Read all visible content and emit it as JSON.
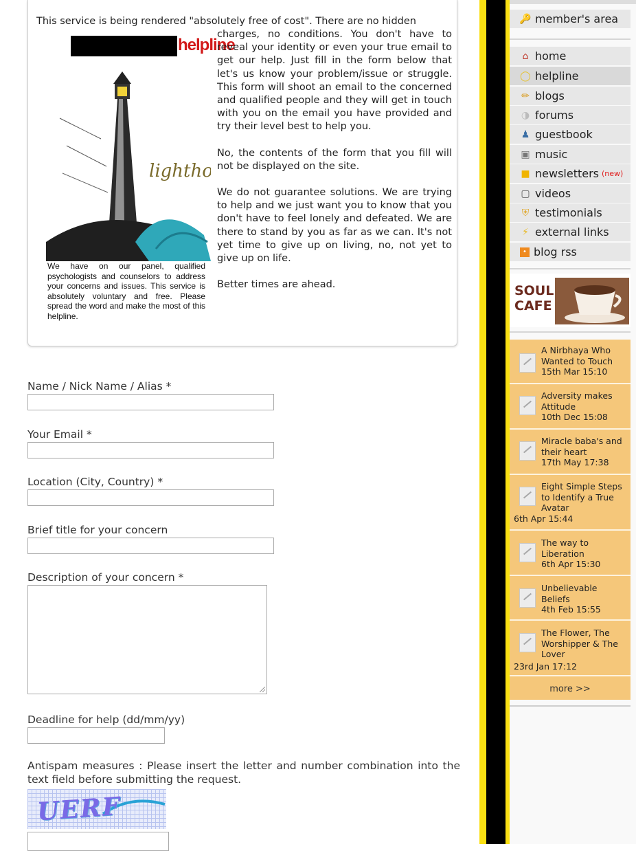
{
  "intro": {
    "lead": "This service is being rendered \"absolutely free of cost\". There are no hidden",
    "paragraphs": [
      "charges, no conditions. You don't have to reveal your identity or even your true email to get our help. Just fill in the form below that let's us know your problem/issue or struggle. This form will shoot an email to the concerned and qualified people and they will get in touch with you on the email you have provided and try their level best to help you.",
      "No, the contents of the form that you fill will not be displayed on the site.",
      "We do not guarantee solutions. We are trying to help and we just want you to know that you don't have to feel lonely and defeated. We are there to stand by you as far as we can. It's not yet time to give up on living, no, not yet to give up on life.",
      "Better times are ahead."
    ],
    "logo_text": "helpline",
    "lighthouse_logo": "lighthouse",
    "caption": "We have on our panel, qualified psychologists and counselors to address your concerns and issues. This service is absolutely voluntary and free. Please spread the word and make the most of this helpline."
  },
  "form": {
    "name_label": "Name / Nick Name / Alias *",
    "email_label": "Your Email *",
    "location_label": "Location (City, Country) *",
    "title_label": "Brief title for your concern",
    "description_label": "Description of your concern *",
    "deadline_label": "Deadline for help (dd/mm/yy)",
    "antispam_text": "Antispam measures : Please insert the letter and number combination into the text field before submitting the request.",
    "captcha_text": "UERF"
  },
  "sidebar": {
    "member_area": "member's area",
    "nav": [
      {
        "label": "home",
        "icon": "home-icon"
      },
      {
        "label": "helpline",
        "icon": "lightbulb-icon"
      },
      {
        "label": "blogs",
        "icon": "pencil-icon"
      },
      {
        "label": "forums",
        "icon": "forums-icon"
      },
      {
        "label": "guestbook",
        "icon": "guestbook-icon"
      },
      {
        "label": "music",
        "icon": "music-icon"
      },
      {
        "label": "newsletters",
        "icon": "newsletter-icon",
        "badge": "(new)"
      },
      {
        "label": "videos",
        "icon": "tv-icon"
      },
      {
        "label": "testimonials",
        "icon": "shield-icon"
      },
      {
        "label": "external links",
        "icon": "lightning-icon"
      },
      {
        "label": "blog rss",
        "icon": "rss-icon"
      }
    ],
    "soul_cafe": "SOUL CAFE",
    "posts": [
      {
        "title": "A Nirbhaya Who Wanted to Touch",
        "date": "15th Mar 15:10"
      },
      {
        "title": "Adversity makes Attitude",
        "date": "10th Dec 15:08"
      },
      {
        "title": "Miracle baba's and their heart",
        "date": "17th May 17:38"
      },
      {
        "title": "Eight Simple Steps to Identify a True Avatar",
        "date": "6th Apr 15:44"
      },
      {
        "title": "The way to Liberation",
        "date": "6th Apr 15:30"
      },
      {
        "title": "Unbelievable Beliefs",
        "date": "4th Feb 15:55"
      },
      {
        "title": "The Flower, The Worshipper & The Lover",
        "date": "23rd Jan 17:12"
      }
    ],
    "more": "more >>"
  },
  "colors": {
    "stripe_yellow": "#fae013",
    "stripe_black": "#000000",
    "posts_bg": "#f5c77a",
    "helpline_red": "#d21a1a"
  }
}
